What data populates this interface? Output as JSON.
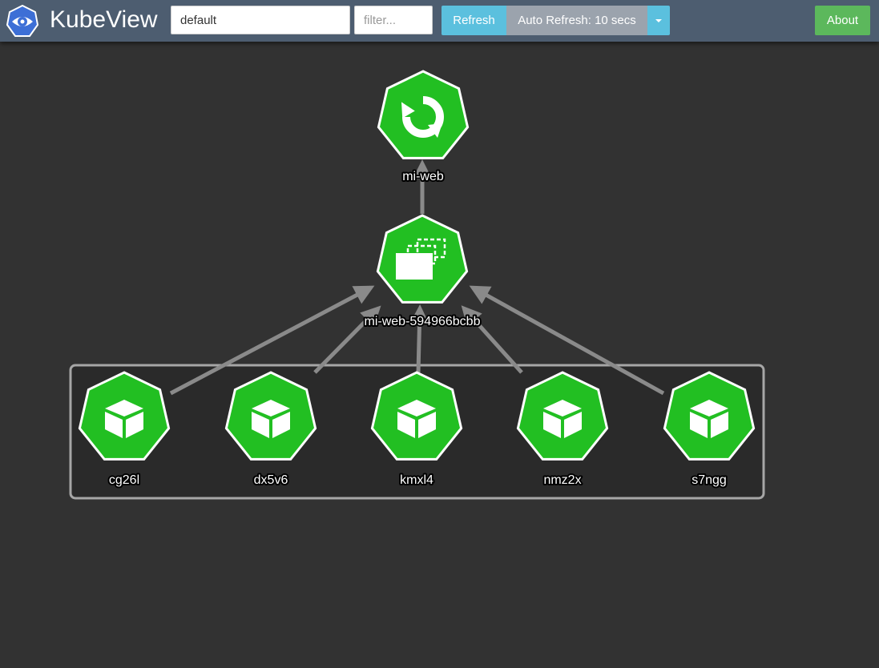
{
  "app": {
    "title": "KubeView",
    "logo_icon": "kubeview-eye-icon"
  },
  "toolbar": {
    "namespace_value": "default",
    "filter_placeholder": "filter...",
    "refresh_label": "Refresh",
    "auto_refresh_label": "Auto Refresh: 10 secs",
    "dropdown_icon": "caret-down-icon",
    "about_label": "About"
  },
  "colors": {
    "navbar": "#4d5d70",
    "background": "#323232",
    "node_fill": "#22bf22",
    "refresh_button": "#5bc0de",
    "auto_refresh_button": "#9ba3ad",
    "about_button": "#5cb85c",
    "edge": "#8a8a8a"
  },
  "graph": {
    "deployment": {
      "label": "mi-web",
      "icon": "deployment-refresh-icon"
    },
    "replicaset": {
      "label": "mi-web-594966bcbb",
      "icon": "replicaset-icon"
    },
    "pods": [
      {
        "label": "cg26l",
        "icon": "pod-cube-icon"
      },
      {
        "label": "dx5v6",
        "icon": "pod-cube-icon"
      },
      {
        "label": "kmxl4",
        "icon": "pod-cube-icon"
      },
      {
        "label": "nmz2x",
        "icon": "pod-cube-icon"
      },
      {
        "label": "s7ngg",
        "icon": "pod-cube-icon"
      }
    ]
  }
}
